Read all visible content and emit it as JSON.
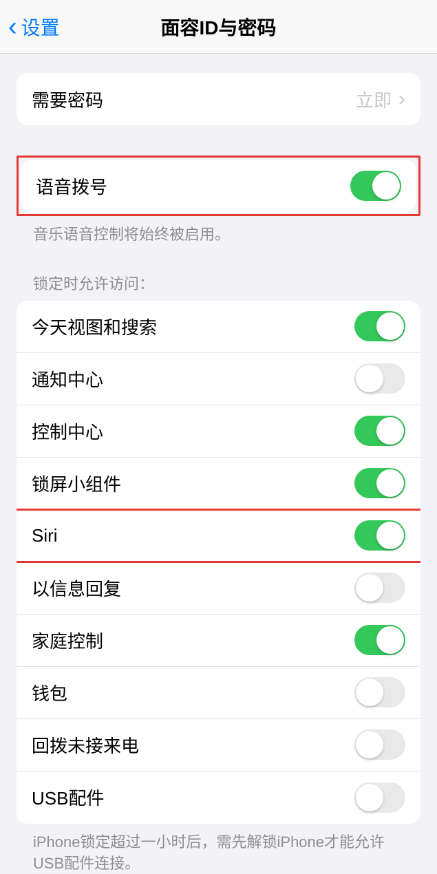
{
  "nav": {
    "back_label": "设置",
    "title": "面容ID与密码"
  },
  "require_passcode": {
    "label": "需要密码",
    "value": "立即"
  },
  "voice_dial": {
    "label": "语音拨号",
    "footer": "音乐语音控制将始终被启用。"
  },
  "lock_access": {
    "header": "锁定时允许访问：",
    "items": [
      {
        "label": "今天视图和搜索",
        "on": true,
        "highlighted": false
      },
      {
        "label": "通知中心",
        "on": false,
        "highlighted": false
      },
      {
        "label": "控制中心",
        "on": true,
        "highlighted": false
      },
      {
        "label": "锁屏小组件",
        "on": true,
        "highlighted": false
      },
      {
        "label": "Siri",
        "on": true,
        "highlighted": true
      },
      {
        "label": "以信息回复",
        "on": false,
        "highlighted": false
      },
      {
        "label": "家庭控制",
        "on": true,
        "highlighted": false
      },
      {
        "label": "钱包",
        "on": false,
        "highlighted": false
      },
      {
        "label": "回拨未接来电",
        "on": false,
        "highlighted": false
      },
      {
        "label": "USB配件",
        "on": false,
        "highlighted": false
      }
    ],
    "footer": "iPhone锁定超过一小时后，需先解锁iPhone才能允许USB配件连接。"
  }
}
